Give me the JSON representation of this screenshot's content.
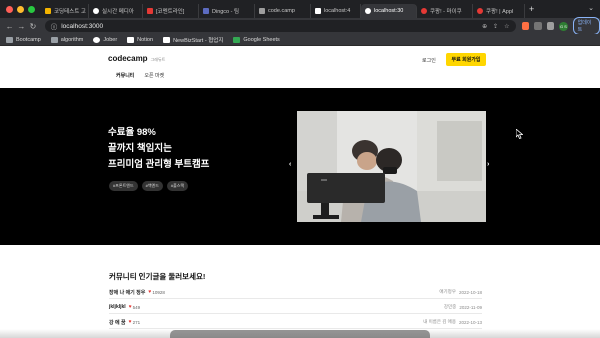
{
  "browser": {
    "tabs": [
      {
        "label": "코딩테스트 고",
        "color": "#f4b400"
      },
      {
        "label": "실시간 메디아",
        "color": "#ffffff"
      },
      {
        "label": "[코멘트라인]",
        "color": "#e53935"
      },
      {
        "label": "Dingco - 팀",
        "color": "#5c6bc0"
      },
      {
        "label": "code.camp",
        "color": "#9e9e9e"
      },
      {
        "label": "localhost:4",
        "color": "#ffffff"
      },
      {
        "label": "localhost:30",
        "color": "#ffffff"
      },
      {
        "label": "쿠팡! - 마이쿠",
        "color": "#e53935"
      },
      {
        "label": "쿠팡! | Appl",
        "color": "#e53935"
      }
    ],
    "new_tab": "+",
    "url": "localhost:3000",
    "profile_initials": "G S",
    "update_label": "업데이트",
    "bookmarks": [
      {
        "label": "Bootcamp"
      },
      {
        "label": "algorithm"
      },
      {
        "label": "Jober"
      },
      {
        "label": "Notion"
      },
      {
        "label": "NewBizStart - 협업지"
      },
      {
        "label": "Google Sheets"
      }
    ]
  },
  "header": {
    "logo": "codecamp",
    "logo_sub": "그래듀트",
    "menu": [
      "커뮤니티",
      "오픈 마켓"
    ],
    "login": "로그인",
    "signup": "무료 회원가입"
  },
  "hero": {
    "lines": [
      "수료율 98%",
      "끝까지 책임지는",
      "프리미엄 관리형 부트캠프"
    ],
    "tags": [
      "#프론트엔드",
      "#백엔드",
      "#풀스택"
    ],
    "prev": "‹",
    "next": "›"
  },
  "community": {
    "title": "커뮤니티 인기글을 둘러보세요!",
    "posts": [
      {
        "title": "장애 나 애기 정우",
        "likes": "10928",
        "author": "애기정우",
        "date": "2022-10-18"
      },
      {
        "title": "jkljkljkl",
        "likes": "549",
        "author": "강민중",
        "date": "2022-11-09"
      },
      {
        "title": "강 에 꿈",
        "likes": "271",
        "author": "내 이름은 김 애용",
        "date": "2022-10-13"
      }
    ]
  },
  "colors": {
    "accent": "#ffd600",
    "hero_bg": "#000000",
    "heart": "#e53935"
  }
}
